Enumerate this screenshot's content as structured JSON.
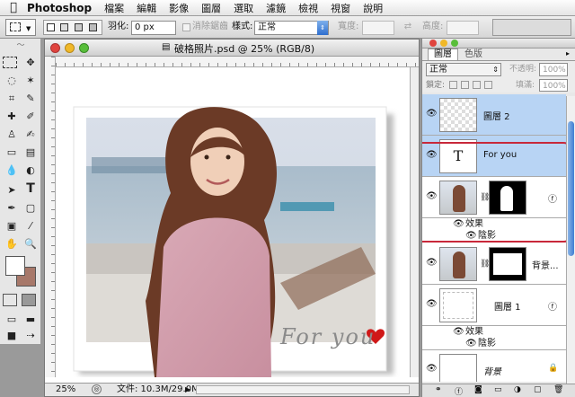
{
  "menubar": {
    "app": "Photoshop",
    "items": [
      "檔案",
      "編輯",
      "影像",
      "圖層",
      "選取",
      "濾鏡",
      "檢視",
      "視窗",
      "說明"
    ]
  },
  "options": {
    "feather_label": "羽化:",
    "feather_value": "0 px",
    "antialias_label": "消除鋸齒",
    "style_label": "樣式:",
    "style_value": "正常",
    "width_label": "寬度:",
    "height_label": "高度:"
  },
  "document": {
    "title": "破格照片.psd @ 25% (RGB/8)",
    "zoom": "25%",
    "file_info": "文件: 10.3M/29.0M",
    "canvas_text": "For you"
  },
  "layers_panel": {
    "tabs": [
      "圖層",
      "色版"
    ],
    "blend_mode": "正常",
    "opacity_label": "不透明:",
    "opacity_value": "100%",
    "lock_label": "鎖定:",
    "fill_label": "填滿:",
    "fill_value": "100%",
    "layers": [
      {
        "name": "圖層 2",
        "selected": true
      },
      {
        "name": "For you",
        "selected": true,
        "type_icon": "T"
      },
      {
        "name": "",
        "selected": false
      },
      {
        "name": "背景...",
        "selected": false
      },
      {
        "name": "圖層 1",
        "selected": false
      },
      {
        "name": "背景",
        "selected": false
      }
    ],
    "effects_label": "效果",
    "shadow_label": "陰影"
  },
  "colors": {
    "selection_blue": "#b8d4f4",
    "highlight_red": "#c8283a",
    "heart_red": "#d01818"
  }
}
